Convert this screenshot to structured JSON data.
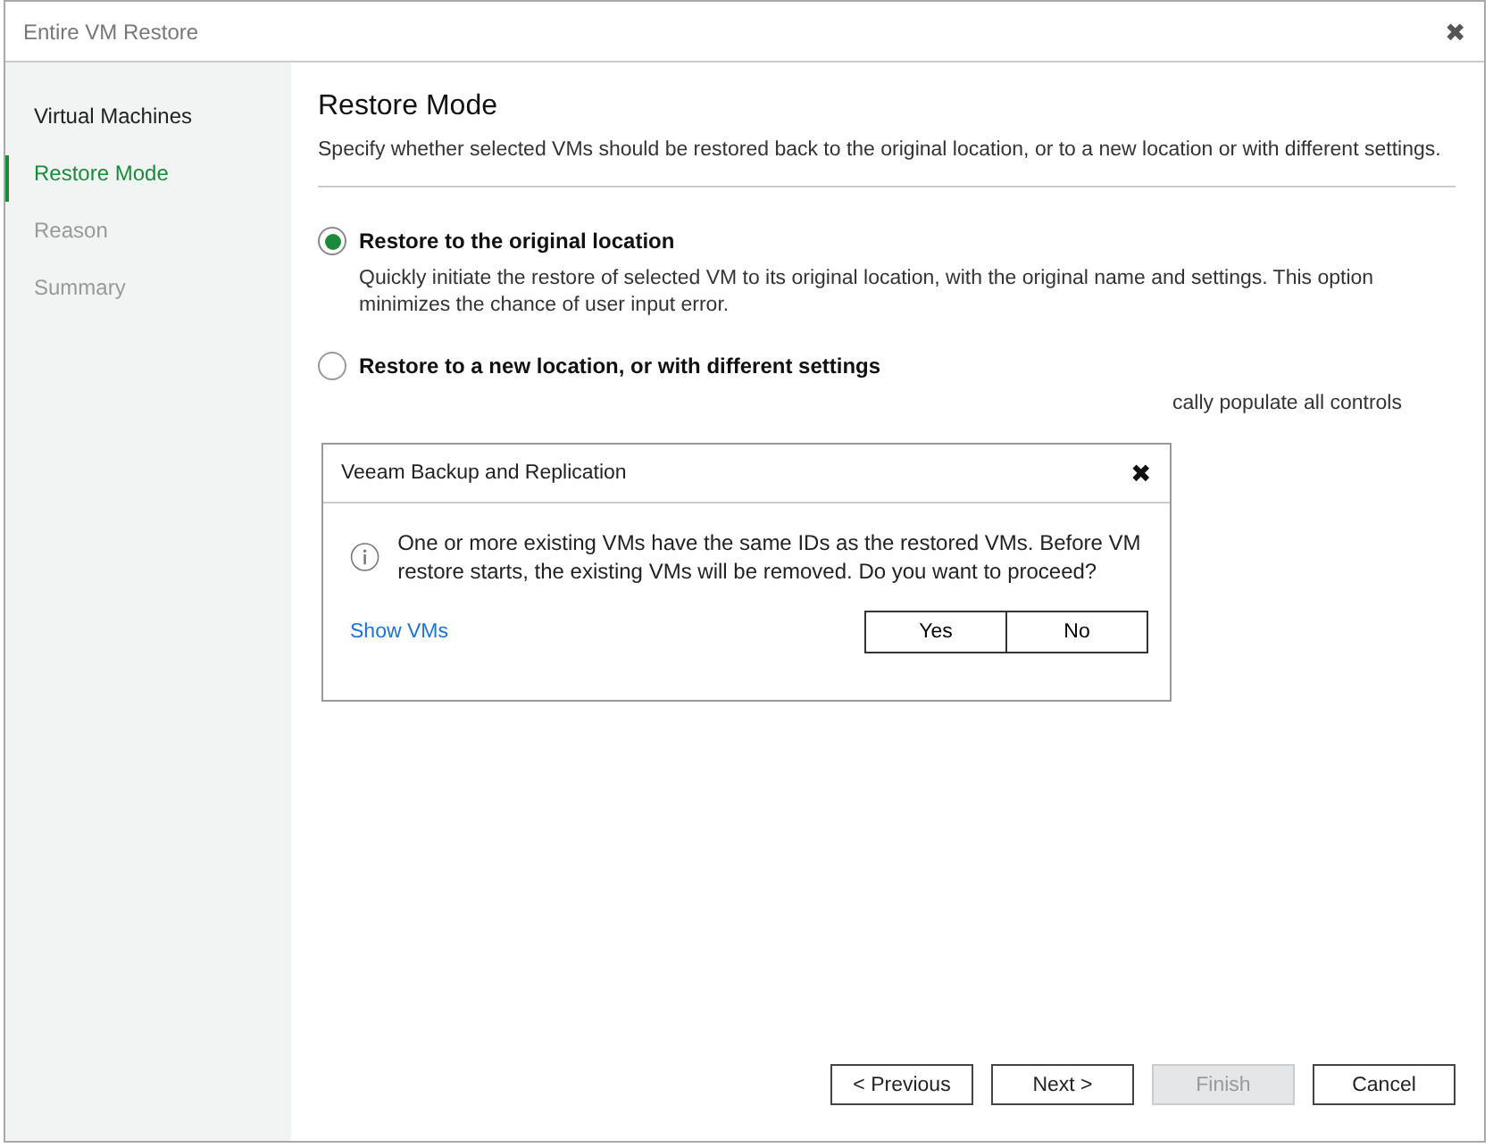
{
  "window": {
    "title": "Entire VM Restore",
    "close": "✖"
  },
  "sidebar": {
    "items": [
      {
        "label": "Virtual Machines",
        "disabled": false,
        "selected": false
      },
      {
        "label": "Restore Mode",
        "disabled": false,
        "selected": true
      },
      {
        "label": "Reason",
        "disabled": true,
        "selected": false
      },
      {
        "label": "Summary",
        "disabled": true,
        "selected": false
      }
    ]
  },
  "page": {
    "title": "Restore Mode",
    "description": "Specify whether selected VMs should be restored back to the original location, or to a new location or with different settings."
  },
  "options": [
    {
      "label": "Restore to the original location",
      "selected": true,
      "description": "Quickly initiate the restore of selected VM to its original location, with the original name and settings. This option minimizes the chance of user input error."
    },
    {
      "label": "Restore to a new location, or with different settings",
      "selected": false,
      "description": "cally populate all controls"
    }
  ],
  "dialog": {
    "title": "Veeam Backup and Replication",
    "close": "✖",
    "message": "One or more existing VMs have the same IDs as the restored VMs. Before VM restore starts, the existing VMs will be removed. Do you want to proceed?",
    "link": "Show VMs",
    "buttons": [
      "Yes",
      "No"
    ]
  },
  "footer": {
    "buttons": [
      {
        "label": "< Previous",
        "disabled": false
      },
      {
        "label": "Next >",
        "disabled": false
      },
      {
        "label": "Finish",
        "disabled": true
      },
      {
        "label": "Cancel",
        "disabled": false
      }
    ]
  }
}
